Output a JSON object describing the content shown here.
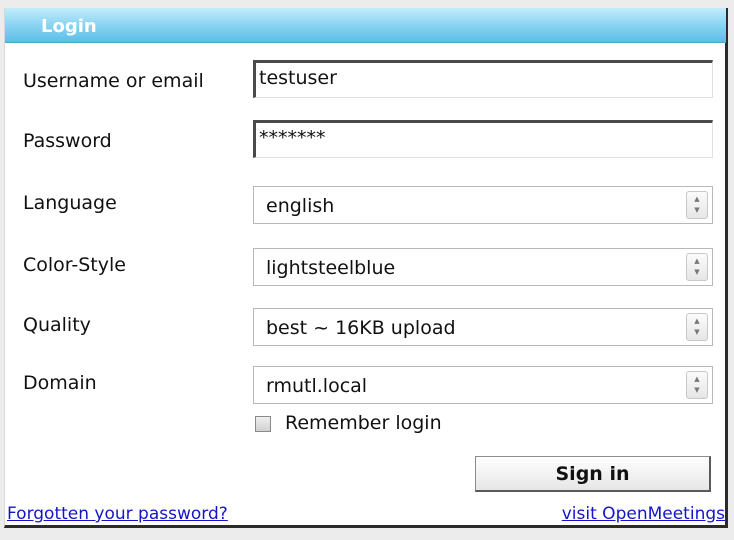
{
  "window": {
    "title": "Login"
  },
  "form": {
    "username": {
      "label": "Username or email",
      "value": "testuser"
    },
    "password": {
      "label": "Password",
      "value": "*******"
    },
    "language": {
      "label": "Language",
      "value": "english"
    },
    "color_style": {
      "label": "Color-Style",
      "value": "lightsteelblue"
    },
    "quality": {
      "label": "Quality",
      "value": "best ~ 16KB upload"
    },
    "domain": {
      "label": "Domain",
      "value": "rmutl.local"
    },
    "remember": {
      "label": "Remember login",
      "checked": false
    },
    "submit_label": "Sign in"
  },
  "links": {
    "forgot": "Forgotten your password?",
    "visit": "visit OpenMeetings"
  },
  "icons": {
    "stepper": "up-down-stepper-icon",
    "checkbox": "checkbox-icon"
  },
  "colors": {
    "title_bar": "#5cbde6",
    "link": "#1515c8"
  }
}
